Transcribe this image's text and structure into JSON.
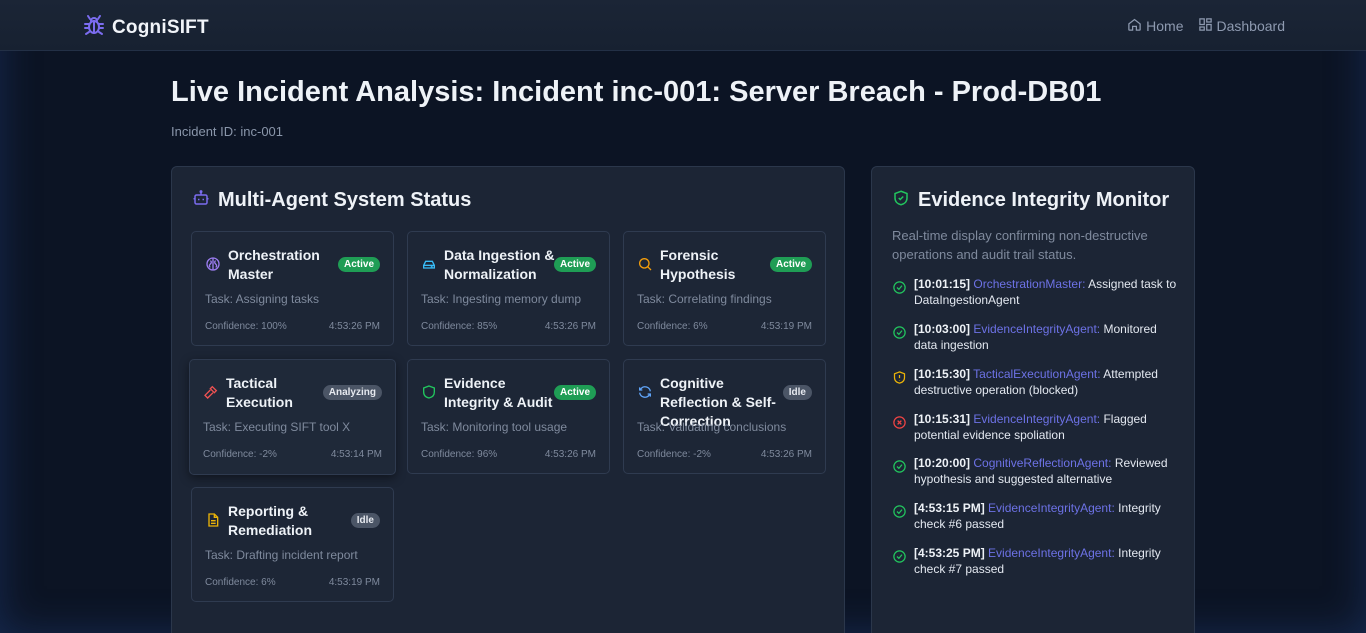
{
  "app": {
    "brand": "CogniSIFT",
    "nav": [
      {
        "label": "Home",
        "icon": "home-icon"
      },
      {
        "label": "Dashboard",
        "icon": "dashboard-icon"
      }
    ]
  },
  "page": {
    "title": "Live Incident Analysis: Incident inc-001: Server Breach - Prod-DB01",
    "incident_id": "Incident ID: inc-001"
  },
  "agents_panel": {
    "title": "Multi-Agent System Status",
    "icon": "bot-icon",
    "agents": [
      {
        "name": "Orchestration Master",
        "status": "Active",
        "task": "Task: Assigning tasks",
        "confidence": "Confidence: 100%",
        "time": "4:53:26 PM",
        "icon": "brain-icon",
        "icon_color": "#9b7cf0"
      },
      {
        "name": "Data Ingestion & Normalization",
        "status": "Active",
        "task": "Task: Ingesting memory dump",
        "confidence": "Confidence: 85%",
        "time": "4:53:26 PM",
        "icon": "database-icon",
        "icon_color": "#38bdf8"
      },
      {
        "name": "Forensic Hypothesis",
        "status": "Active",
        "task": "Task: Correlating findings",
        "confidence": "Confidence: 6%",
        "time": "4:53:19 PM",
        "icon": "search-icon",
        "icon_color": "#f59e0b"
      },
      {
        "name": "Tactical Execution",
        "status": "Analyzing",
        "task": "Task: Executing SIFT tool X",
        "confidence": "Confidence: -2%",
        "time": "4:53:14 PM",
        "icon": "hammer-icon",
        "icon_color": "#f05252"
      },
      {
        "name": "Evidence Integrity & Audit",
        "status": "Active",
        "task": "Task: Monitoring tool usage",
        "confidence": "Confidence: 96%",
        "time": "4:53:26 PM",
        "icon": "shield-icon",
        "icon_color": "#22c55e"
      },
      {
        "name": "Cognitive Reflection & Self-Correction",
        "status": "Idle",
        "task": "Task: Validating conclusions",
        "confidence": "Confidence: -2%",
        "time": "4:53:26 PM",
        "icon": "refresh-icon",
        "icon_color": "#60a5fa"
      },
      {
        "name": "Reporting & Remediation",
        "status": "Idle",
        "task": "Task: Drafting incident report",
        "confidence": "Confidence: 6%",
        "time": "4:53:19 PM",
        "icon": "file-icon",
        "icon_color": "#eab308"
      }
    ]
  },
  "monitor_panel": {
    "title": "Evidence Integrity Monitor",
    "icon": "shield-check-icon",
    "description": "Real-time display confirming non-destructive operations and audit trail status.",
    "logs": [
      {
        "time": "[10:01:15]",
        "agent": "OrchestrationMaster:",
        "message": "Assigned task to DataIngestionAgent",
        "status": "ok"
      },
      {
        "time": "[10:03:00]",
        "agent": "EvidenceIntegrityAgent:",
        "message": "Monitored data ingestion",
        "status": "ok"
      },
      {
        "time": "[10:15:30]",
        "agent": "TacticalExecutionAgent:",
        "message": "Attempted destructive operation (blocked)",
        "status": "warn"
      },
      {
        "time": "[10:15:31]",
        "agent": "EvidenceIntegrityAgent:",
        "message": "Flagged potential evidence spoliation",
        "status": "error"
      },
      {
        "time": "[10:20:00]",
        "agent": "CognitiveReflectionAgent:",
        "message": "Reviewed hypothesis and suggested alternative",
        "status": "ok"
      },
      {
        "time": "[4:53:15 PM]",
        "agent": "EvidenceIntegrityAgent:",
        "message": "Integrity check #6 passed",
        "status": "ok"
      },
      {
        "time": "[4:53:25 PM]",
        "agent": "EvidenceIntegrityAgent:",
        "message": "Integrity check #7 passed",
        "status": "ok"
      }
    ]
  },
  "colors": {
    "accent": "#6d72e6",
    "active": "#1f9d55",
    "ok": "#22c55e",
    "warn": "#eab308",
    "error": "#ef4444"
  }
}
